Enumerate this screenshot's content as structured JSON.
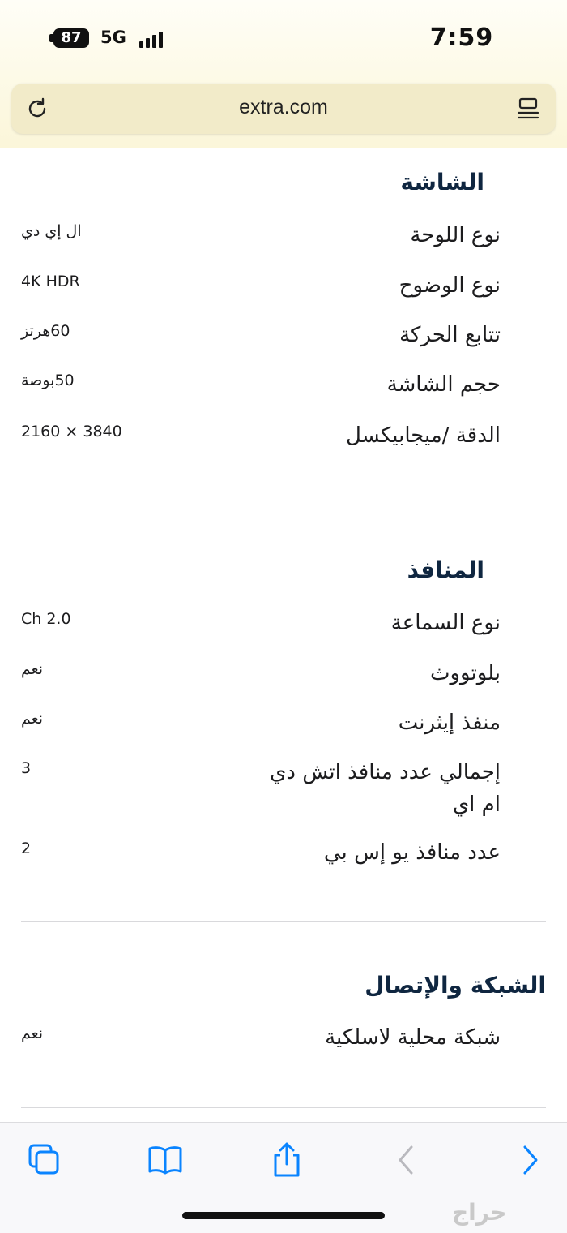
{
  "status_bar": {
    "battery": "87",
    "network": "5G",
    "time": "7:59"
  },
  "browser": {
    "url": "extra.com"
  },
  "sections": [
    {
      "title": "الشاشة",
      "rows": [
        {
          "label": "نوع اللوحة",
          "value": "ال إي دي"
        },
        {
          "label": "نوع الوضوح",
          "value": "4K HDR"
        },
        {
          "label": "تتابع الحركة",
          "value": "60هرتز"
        },
        {
          "label": "حجم الشاشة",
          "value": "50بوصة"
        },
        {
          "label": "الدقة /ميجابيكسل",
          "value": "2160 × 3840"
        }
      ]
    },
    {
      "title": "المنافذ",
      "rows": [
        {
          "label": "نوع السماعة",
          "value": "Ch 2.0"
        },
        {
          "label": "بلوتووث",
          "value": "نعم"
        },
        {
          "label": "منفذ إيثرنت",
          "value": "نعم"
        },
        {
          "label": "إجمالي عدد منافذ اتش دي ام اي",
          "value": "3"
        },
        {
          "label": "عدد منافذ يو إس بي",
          "value": "2"
        }
      ]
    },
    {
      "title": "الشبكة والإتصال",
      "rows": [
        {
          "label": "شبكة محلية لاسلكية",
          "value": "نعم"
        }
      ]
    }
  ],
  "toolbar": {
    "icons": [
      "tabs-icon",
      "bookmarks-icon",
      "share-icon",
      "back-icon",
      "forward-icon"
    ]
  },
  "watermark": "حراج",
  "colors": {
    "heading": "#0f2640",
    "accent": "#0a84ff",
    "url_bar": "#f2ebc9"
  }
}
